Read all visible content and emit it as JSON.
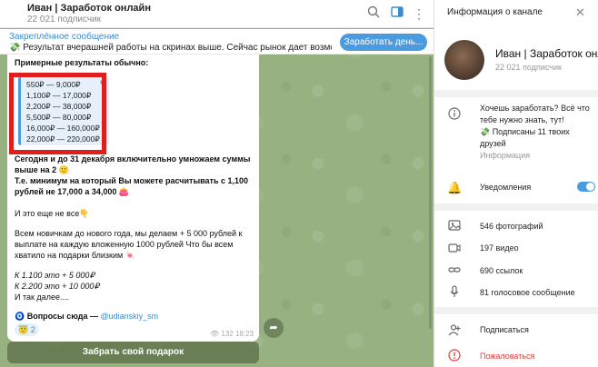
{
  "chat": {
    "title": "Иван | Заработок онлайн",
    "subtitle": "22 021 подписчик"
  },
  "pinned": {
    "title": "Закреплённое сообщение",
    "text": "💸 Результат вчерашней работы на скринах выше. Сейчас рынок дает возможность з...",
    "button": "Заработать день..."
  },
  "message": {
    "heading": "Примерные результаты обычно:",
    "results": [
      "550₽ — 9,000₽",
      "1,100₽ — 17,000₽",
      "2,200₽ — 38,000₽",
      "5,500₽ — 80,000₽",
      "16,000₽ — 160,000₽",
      "22,000₽ — 220,000₽"
    ],
    "para1_line1": "Сегодня и до 31 декабря включительно умножаем суммы",
    "para1_line2": "выше на 2 🙂",
    "para1_line3": "Т.е. минимум на который Вы можете расчитывать с 1,100",
    "para1_line4": "рублей не 17,000 а 34,000 👛",
    "para2": "И это еще не все👇",
    "para3_line1": "Всем новичкам до нового года, мы делаем + 5 000 рублей к",
    "para3_line2": "выплате на каждую вложенную 1000 рублей Что бы всем",
    "para3_line3": "хватило на подарки близким 🍬",
    "italic1": "К 1.100 это + 5 000₽",
    "italic2": "К 2.200 это + 10 000₽",
    "italic3": "И так далее....",
    "questions_prefix": "🧿 Вопросы сюда — ",
    "questions_link": "@udianskiy_sm",
    "reaction": "😇 2",
    "meta": "👁 132  18:23"
  },
  "gift_button": "Забрать свой подарок",
  "info": {
    "title": "Информация о канале",
    "name": "Иван | Заработок онлайн",
    "subscribers": "22 021 подписчик",
    "description_line1": "Хочешь заработать? Всё что",
    "description_line2": "тебе нужно знать, тут!",
    "description_line3": "💸 Подписаны 11 твоих",
    "description_line4": "друзей",
    "description_label": "Информация",
    "notifications": "Уведомления",
    "photos": "546 фотографий",
    "videos": "197 видео",
    "links": "690 ссылок",
    "voice": "81 голосовое сообщение",
    "subscribe": "Подписаться",
    "report": "Пожаловаться"
  },
  "colors": {
    "accent": "#4a9be0",
    "highlight": "#e01e1e",
    "wallpaper": "#97b180"
  }
}
